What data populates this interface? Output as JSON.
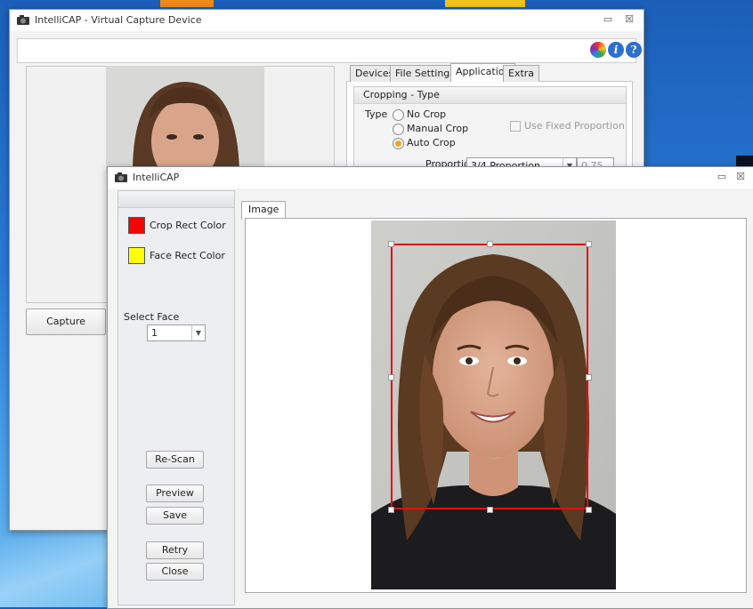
{
  "back_window": {
    "title": "IntelliCAP - Virtual Capture Device",
    "controls": {
      "minimize": "▭",
      "close": "☒"
    },
    "toolbar_icons": [
      "color-wheel-icon",
      "info-icon",
      "help-icon"
    ],
    "toolbar_glyphs": {
      "info": "i",
      "help": "?"
    },
    "capture_label": "Capture",
    "tabs": [
      "Devices",
      "File Settings",
      "Application",
      "Extra"
    ],
    "active_tab": "Application",
    "cropping": {
      "header": "Cropping - Type",
      "type_label": "Type",
      "options": [
        "No Crop",
        "Manual Crop",
        "Auto Crop"
      ],
      "selected": "Auto Crop",
      "fixed_proportion_label": "Use Fixed Proportion",
      "proportion_label": "Proportion",
      "proportion_value": "3/4 Proportion",
      "proportion_number": "0.75"
    }
  },
  "front_window": {
    "title": "IntelliCAP",
    "controls": {
      "minimize": "▭",
      "close": "☒"
    },
    "crop_rect_color_label": "Crop Rect Color",
    "face_rect_color_label": "Face Rect Color",
    "colors": {
      "crop_rect": "#ff0000",
      "face_rect": "#ffff00"
    },
    "select_face_label": "Select Face",
    "select_face_value": "1",
    "buttons": {
      "rescan": "Re-Scan",
      "preview": "Preview",
      "save": "Save",
      "retry": "Retry",
      "close": "Close"
    },
    "image_tab": "Image"
  }
}
